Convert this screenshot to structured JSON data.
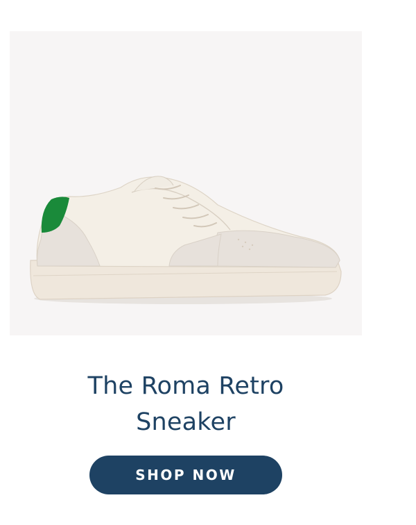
{
  "product": {
    "title": "The Roma Retro Sneaker",
    "image_subject": "white-leather-sneaker-green-heel",
    "accent_color": "#1a8a3a"
  },
  "cta": {
    "label": "SHOP NOW",
    "color": "#1e4263"
  }
}
